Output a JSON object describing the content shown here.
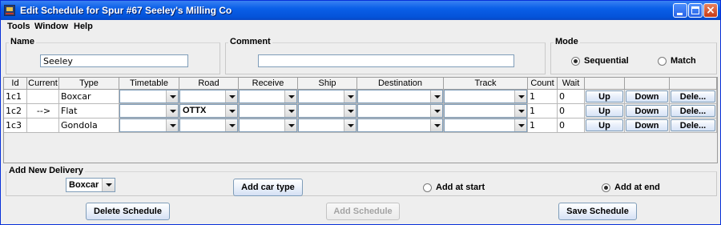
{
  "window": {
    "title": "Edit Schedule for Spur #67 Seeley's Milling Co",
    "minimize_glyph": "",
    "maximize_glyph": "",
    "close_glyph": "×"
  },
  "menu": {
    "items": [
      "Tools",
      "Window",
      "Help"
    ]
  },
  "name_group": {
    "title": "Name",
    "value": "Seeley"
  },
  "comment_group": {
    "title": "Comment",
    "value": ""
  },
  "mode_group": {
    "title": "Mode",
    "options": [
      {
        "label": "Sequential",
        "checked": true
      },
      {
        "label": "Match",
        "checked": false
      }
    ]
  },
  "table": {
    "columns": [
      "Id",
      "Current",
      "Type",
      "Timetable",
      "Road",
      "Receive",
      "Ship",
      "Destination",
      "Track",
      "Count",
      "Wait",
      "",
      "",
      ""
    ],
    "rows": [
      {
        "id": "1c1",
        "current": "",
        "type": "Boxcar",
        "timetable": "",
        "road": "",
        "receive": "",
        "ship": "",
        "destination": "",
        "track": "",
        "count": "1",
        "wait": "0",
        "up": "Up",
        "down": "Down",
        "delete": "Dele..."
      },
      {
        "id": "1c2",
        "current": "-->",
        "type": "Flat",
        "timetable": "",
        "road": "OTTX",
        "receive": "",
        "ship": "",
        "destination": "",
        "track": "",
        "count": "1",
        "wait": "0",
        "up": "Up",
        "down": "Down",
        "delete": "Dele..."
      },
      {
        "id": "1c3",
        "current": "",
        "type": "Gondola",
        "timetable": "",
        "road": "",
        "receive": "",
        "ship": "",
        "destination": "",
        "track": "",
        "count": "1",
        "wait": "0",
        "up": "Up",
        "down": "Down",
        "delete": "Dele..."
      }
    ]
  },
  "add_delivery": {
    "title": "Add New Delivery",
    "car_type": "Boxcar",
    "add_button": "Add car type",
    "position_options": [
      {
        "label": "Add at start",
        "checked": false
      },
      {
        "label": "Add at end",
        "checked": true
      }
    ]
  },
  "footer": {
    "delete_label": "Delete Schedule",
    "add_label": "Add Schedule",
    "save_label": "Save Schedule"
  },
  "colors": {
    "titlebar": "#0a5fe8",
    "window_bg": "#eeeeee",
    "close_button": "#c63a16"
  }
}
